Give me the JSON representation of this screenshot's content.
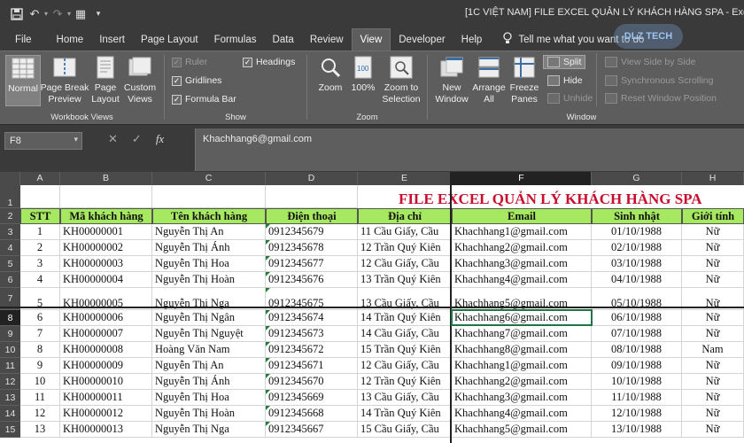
{
  "title_bar": {
    "window_title": "[1C VIỆT NAM] FILE EXCEL QUẢN LÝ KHÁCH HÀNG SPA  -  Excel",
    "quick_access": [
      "save-icon",
      "undo-icon",
      "redo-icon",
      "customize-icon",
      "more-icon"
    ]
  },
  "ribbon_tabs": [
    "File",
    "Home",
    "Insert",
    "Page Layout",
    "Formulas",
    "Data",
    "Review",
    "View",
    "Developer",
    "Help"
  ],
  "active_tab": "View",
  "tell_me": "Tell me what you want to do",
  "logo_text": "DLZ TECH",
  "ribbon": {
    "workbook_views": {
      "label": "Workbook Views",
      "normal": "Normal",
      "page_break": "Page Break Preview",
      "page_layout": "Page Layout",
      "custom": "Custom Views"
    },
    "show": {
      "label": "Show",
      "ruler": "Ruler",
      "gridlines": "Gridlines",
      "formula_bar": "Formula Bar",
      "headings": "Headings"
    },
    "zoom": {
      "label": "Zoom",
      "zoom": "Zoom",
      "hundred": "100%",
      "to_selection": "Zoom to Selection"
    },
    "window": {
      "label": "Window",
      "new_window": "New Window",
      "arrange_all": "Arrange All",
      "freeze_panes": "Freeze Panes",
      "split": "Split",
      "hide": "Hide",
      "unhide": "Unhide",
      "side_by_side": "View Side by Side",
      "sync_scroll": "Synchronous Scrolling",
      "reset_pos": "Reset Window Position"
    }
  },
  "formula_bar": {
    "name_box": "F8",
    "content": "Khachhang6@gmail.com"
  },
  "columns": [
    "A",
    "B",
    "C",
    "D",
    "E",
    "F",
    "G",
    "H"
  ],
  "sheet_title": "FILE EXCEL QUẢN LÝ KHÁCH HÀNG SPA",
  "headers": [
    "STT",
    "Mã khách hàng",
    "Tên khách hàng",
    "Điện thoại",
    "Địa chỉ",
    "Email",
    "Sinh nhật",
    "Giới tính"
  ],
  "row_numbers": [
    "1",
    "2",
    "3",
    "4",
    "5",
    "6",
    "7",
    "8",
    "9",
    "10",
    "11",
    "12",
    "13",
    "14",
    "15"
  ],
  "rows": [
    [
      "1",
      "KH00000001",
      "Nguyễn Thị An",
      "0912345679",
      "11 Cầu Giấy, Cầu",
      "Khachhang1@gmail.com",
      "01/10/1988",
      "Nữ"
    ],
    [
      "2",
      "KH00000002",
      "Nguyễn Thị Ánh",
      "0912345678",
      "12 Trần Quý Kiên",
      "Khachhang2@gmail.com",
      "02/10/1988",
      "Nữ"
    ],
    [
      "3",
      "KH00000003",
      "Nguyễn Thị Hoa",
      "0912345677",
      "12 Cầu Giấy, Cầu",
      "Khachhang3@gmail.com",
      "03/10/1988",
      "Nữ"
    ],
    [
      "4",
      "KH00000004",
      "Nguyễn Thị Hoàn",
      "0912345676",
      "13 Trần Quý Kiên",
      "Khachhang4@gmail.com",
      "04/10/1988",
      "Nữ"
    ],
    [
      "5",
      "KH00000005",
      "Nguyễn Thị Nga",
      "0912345675",
      "13 Cầu Giấy, Cầu",
      "Khachhang5@gmail.com",
      "05/10/1988",
      "Nữ"
    ],
    [
      "6",
      "KH00000006",
      "Nguyễn Thị Ngân",
      "0912345674",
      "14 Trần Quý Kiên",
      "Khachhang6@gmail.com",
      "06/10/1988",
      "Nữ"
    ],
    [
      "7",
      "KH00000007",
      "Nguyễn Thị Nguyệt",
      "0912345673",
      "14 Cầu Giấy, Cầu",
      "Khachhang7@gmail.com",
      "07/10/1988",
      "Nữ"
    ],
    [
      "8",
      "KH00000008",
      "Hoàng Văn Nam",
      "0912345672",
      "15 Trần Quý Kiên",
      "Khachhang8@gmail.com",
      "08/10/1988",
      "Nam"
    ],
    [
      "9",
      "KH00000009",
      "Nguyễn Thị An",
      "0912345671",
      "12 Cầu Giấy, Cầu",
      "Khachhang1@gmail.com",
      "09/10/1988",
      "Nữ"
    ],
    [
      "10",
      "KH00000010",
      "Nguyễn Thị Ánh",
      "0912345670",
      "12 Trần Quý Kiên",
      "Khachhang2@gmail.com",
      "10/10/1988",
      "Nữ"
    ],
    [
      "11",
      "KH00000011",
      "Nguyễn Thị Hoa",
      "0912345669",
      "13 Cầu Giấy, Cầu",
      "Khachhang3@gmail.com",
      "11/10/1988",
      "Nữ"
    ],
    [
      "12",
      "KH00000012",
      "Nguyễn Thị Hoàn",
      "0912345668",
      "14 Trần Quý Kiên",
      "Khachhang4@gmail.com",
      "12/10/1988",
      "Nữ"
    ],
    [
      "13",
      "KH00000013",
      "Nguyễn Thị Nga",
      "0912345667",
      "15 Cầu Giấy, Cầu",
      "Khachhang5@gmail.com",
      "13/10/1988",
      "Nữ"
    ]
  ],
  "colors": {
    "header_fill": "#a6e860",
    "title_red": "#c8102e",
    "ribbon_bg": "#5d5d5d",
    "title_bg": "#3a3a3a"
  }
}
